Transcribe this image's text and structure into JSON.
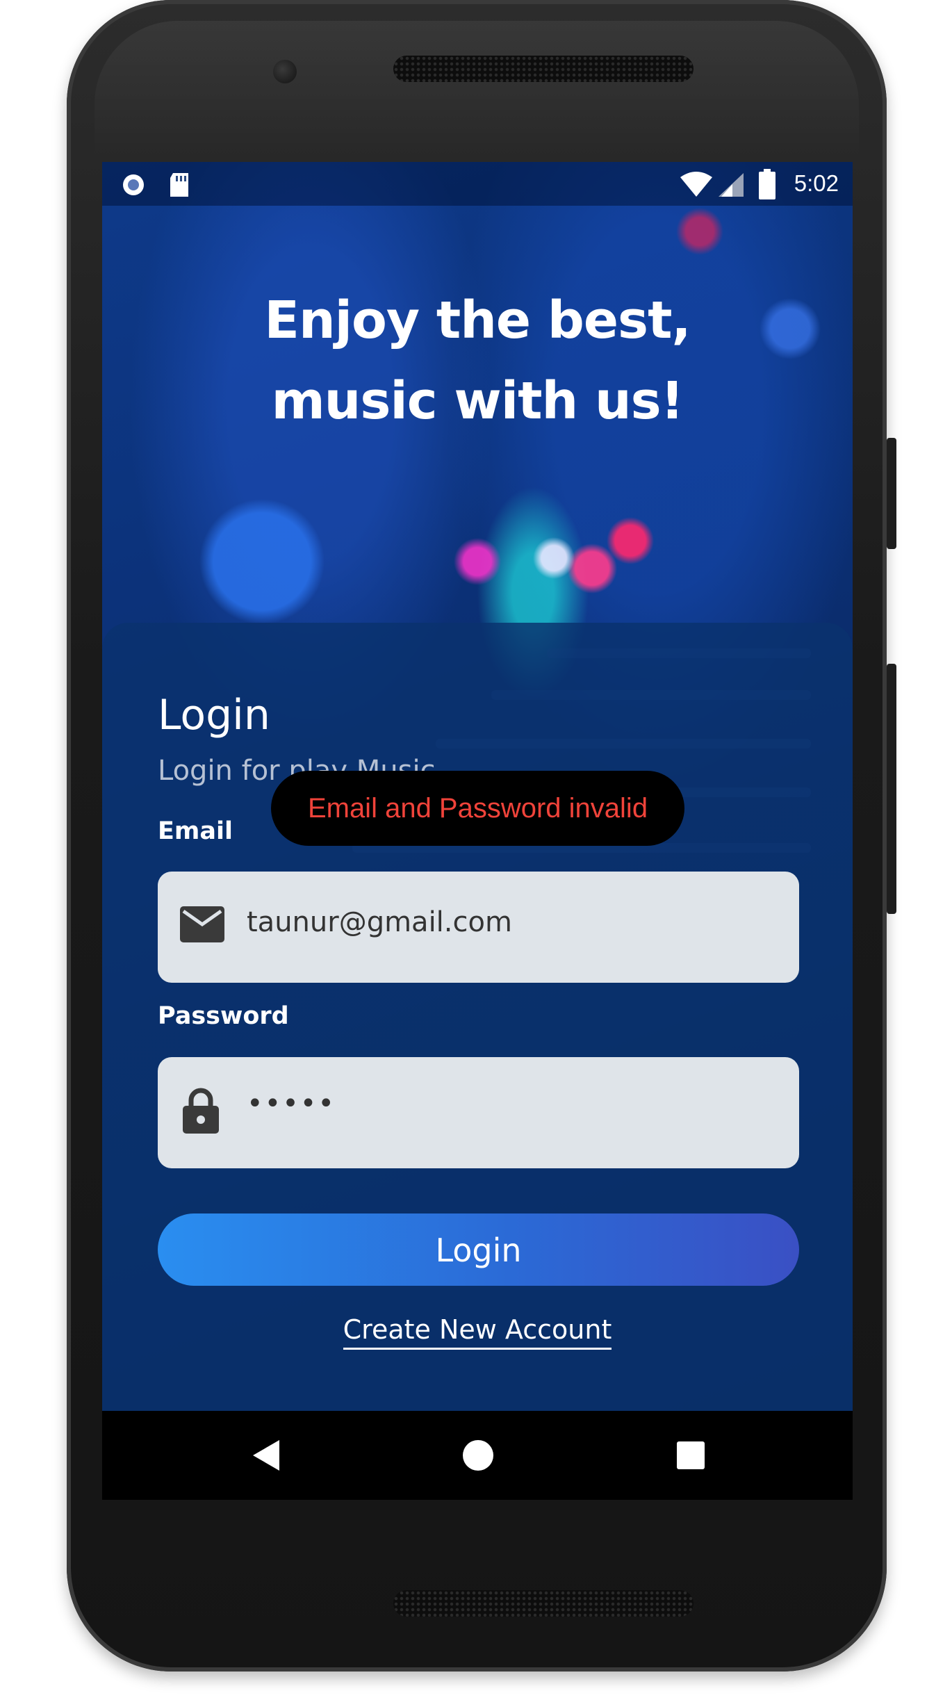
{
  "status_bar": {
    "time": "5:02",
    "left_icons": [
      "circle-notification-icon",
      "sd-card-icon"
    ],
    "right_icons": [
      "wifi-icon",
      "cellular-signal-icon",
      "battery-icon"
    ]
  },
  "hero": {
    "line1": "Enjoy the best,",
    "line2": "music with us!"
  },
  "card": {
    "title": "Login",
    "subtitle": "Login for play Music",
    "email": {
      "label": "Email",
      "value": "taunur@gmail.com",
      "icon": "mail-icon"
    },
    "password": {
      "label": "Password",
      "value": "•••••",
      "icon": "lock-icon"
    },
    "login_button": "Login",
    "create_account": "Create New Account"
  },
  "toast": {
    "message": "Email and Password invalid",
    "color": "#f0433a"
  },
  "nav_bar": {
    "buttons": [
      "back-icon",
      "home-icon",
      "recents-icon"
    ]
  },
  "colors": {
    "accent_gradient_start": "#2a8ef0",
    "accent_gradient_end": "#3a50c4",
    "field_background": "#dfe4e9"
  }
}
